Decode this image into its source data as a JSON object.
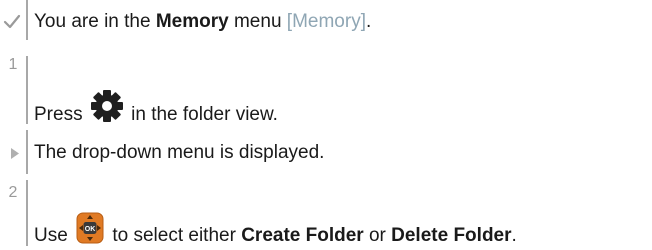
{
  "steps": [
    {
      "marker": "check-icon",
      "parts": [
        "You are in the ",
        "Memory",
        " menu ",
        "[Memory]",
        "."
      ]
    },
    {
      "marker": "1",
      "parts": [
        "Press ",
        " in the folder view."
      ],
      "icon": "gear-icon"
    },
    {
      "marker": "triangle-icon",
      "parts": [
        "The drop-down menu is displayed."
      ]
    },
    {
      "marker": "2",
      "parts": [
        "Use ",
        " to select either ",
        "Create Folder",
        " or ",
        "Delete Folder",
        "."
      ],
      "icon": "ok-joystick-icon",
      "icon_label": "OK"
    }
  ],
  "colors": {
    "text": "#1a1a1a",
    "ref": "#8fa6b4",
    "marker": "#9a9a9a",
    "ok_icon": "#e07a24"
  }
}
